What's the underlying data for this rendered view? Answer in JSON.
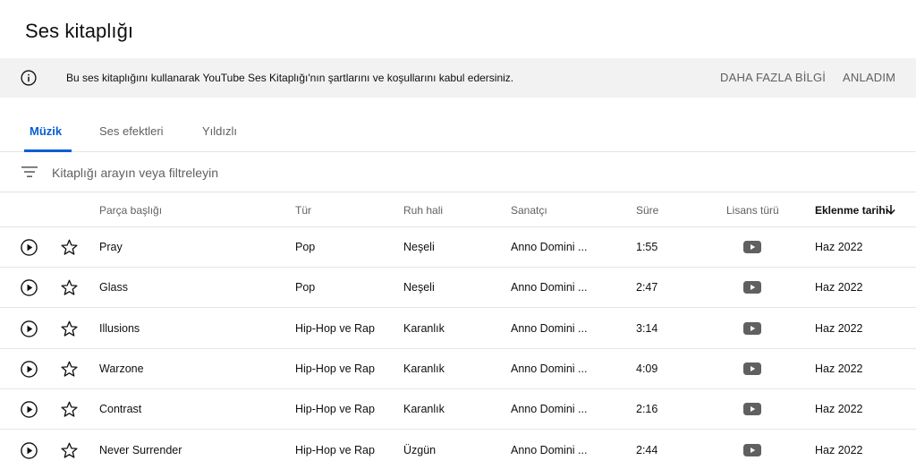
{
  "page": {
    "title": "Ses kitaplığı"
  },
  "banner": {
    "message": "Bu ses kitaplığını kullanarak YouTube Ses Kitaplığı'nın şartlarını ve koşullarını kabul edersiniz.",
    "learn_more": "DAHA FAZLA BİLGİ",
    "dismiss": "ANLADIM"
  },
  "tabs": [
    {
      "label": "Müzik",
      "active": true
    },
    {
      "label": "Ses efektleri",
      "active": false
    },
    {
      "label": "Yıldızlı",
      "active": false
    }
  ],
  "filter": {
    "placeholder": "Kitaplığı arayın veya filtreleyin",
    "value": ""
  },
  "columns": {
    "title": "Parça başlığı",
    "genre": "Tür",
    "mood": "Ruh hali",
    "artist": "Sanatçı",
    "duration": "Süre",
    "license": "Lisans türü",
    "date_added": "Eklenme tarihi"
  },
  "sort": {
    "column": "date_added",
    "direction": "desc",
    "icon": "arrow-down-icon"
  },
  "tracks": [
    {
      "title": "Pray",
      "genre": "Pop",
      "mood": "Neşeli",
      "artist": "Anno Domini ...",
      "duration": "1:55",
      "license_icon": "youtube-icon",
      "date": "Haz 2022"
    },
    {
      "title": "Glass",
      "genre": "Pop",
      "mood": "Neşeli",
      "artist": "Anno Domini ...",
      "duration": "2:47",
      "license_icon": "youtube-icon",
      "date": "Haz 2022"
    },
    {
      "title": "Illusions",
      "genre": "Hip-Hop ve Rap",
      "mood": "Karanlık",
      "artist": "Anno Domini ...",
      "duration": "3:14",
      "license_icon": "youtube-icon",
      "date": "Haz 2022"
    },
    {
      "title": "Warzone",
      "genre": "Hip-Hop ve Rap",
      "mood": "Karanlık",
      "artist": "Anno Domini ...",
      "duration": "4:09",
      "license_icon": "youtube-icon",
      "date": "Haz 2022"
    },
    {
      "title": "Contrast",
      "genre": "Hip-Hop ve Rap",
      "mood": "Karanlık",
      "artist": "Anno Domini ...",
      "duration": "2:16",
      "license_icon": "youtube-icon",
      "date": "Haz 2022"
    },
    {
      "title": "Never Surrender",
      "genre": "Hip-Hop ve Rap",
      "mood": "Üzgün",
      "artist": "Anno Domini ...",
      "duration": "2:44",
      "license_icon": "youtube-icon",
      "date": "Haz 2022"
    }
  ],
  "colors": {
    "accent": "#065fd4",
    "banner_bg": "#f2f2f2",
    "muted_text": "#606060",
    "divider": "#e5e5e5",
    "license_icon": "#606060"
  }
}
